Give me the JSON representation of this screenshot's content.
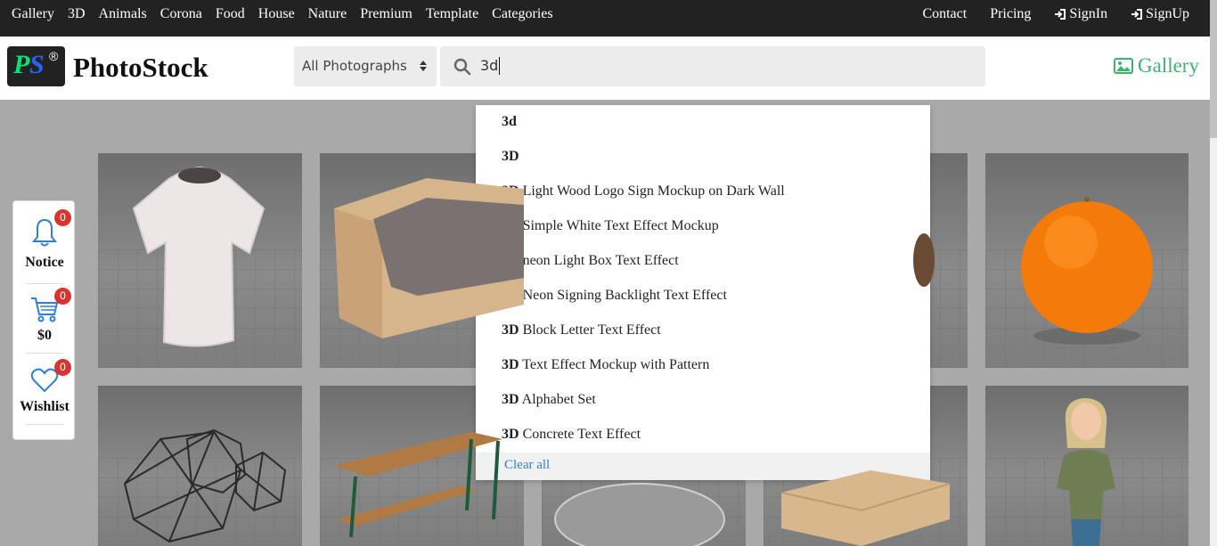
{
  "topnav": {
    "left": [
      "Gallery",
      "3D",
      "Animals",
      "Corona",
      "Food",
      "House",
      "Nature",
      "Premium",
      "Template",
      "Categories"
    ],
    "contact": "Contact",
    "pricing": "Pricing",
    "signin": "SignIn",
    "signup": "SignUp"
  },
  "header": {
    "logo_p": "P",
    "logo_s": "S",
    "logo_r": "®",
    "brand": "PhotoStock",
    "category_selected": "All Photographs",
    "search_value": "3d",
    "gallery_link": "Gallery"
  },
  "side_panel": {
    "notice_label": "Notice",
    "notice_count": "0",
    "cart_label": "$0",
    "cart_count": "0",
    "wishlist_label": "Wishlist",
    "wishlist_count": "0"
  },
  "suggestions": {
    "items": [
      {
        "bold": "3d",
        "rest": ""
      },
      {
        "bold": "3D",
        "rest": ""
      },
      {
        "bold": "3D",
        "rest": " Light Wood Logo Sign Mockup on Dark Wall"
      },
      {
        "bold": "3D",
        "rest": " Simple White Text Effect Mockup"
      },
      {
        "bold": "3D",
        "rest": " neon Light Box Text Effect"
      },
      {
        "bold": "3D",
        "rest": " Neon Signing Backlight Text Effect"
      },
      {
        "bold": "3D",
        "rest": " Block Letter Text Effect"
      },
      {
        "bold": "3D",
        "rest": " Text Effect Mockup with Pattern"
      },
      {
        "bold": "3D",
        "rest": " Alphabet Set"
      },
      {
        "bold": "3D",
        "rest": " Concrete Text Effect"
      }
    ],
    "clear_all": "Clear all"
  },
  "thumbnails": [
    "t-shirt",
    "cardboard box with window",
    "dark object",
    "orange",
    "wireframe spheres",
    "picnic table",
    "glass object",
    "cardboard box",
    "cartoon woman"
  ],
  "colors": {
    "accent_green": "#3cb371",
    "badge_red": "#d9342b",
    "link_blue": "#2f7fd8"
  }
}
